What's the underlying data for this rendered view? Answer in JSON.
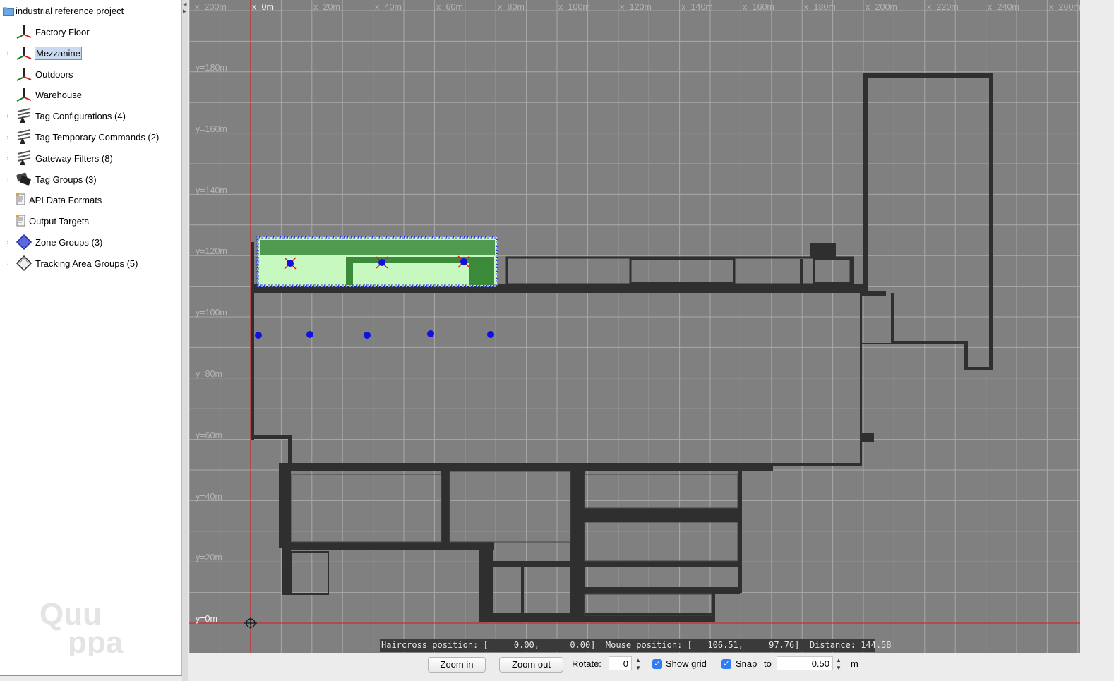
{
  "tree": {
    "root": {
      "label": "industrial reference project",
      "icon": "folder-icon"
    },
    "items": [
      {
        "label": "Factory Floor",
        "icon": "coordinate-axes-icon",
        "expandable": false,
        "selected": false
      },
      {
        "label": "Mezzanine",
        "icon": "coordinate-axes-icon",
        "expandable": true,
        "selected": true
      },
      {
        "label": "Outdoors",
        "icon": "coordinate-axes-icon",
        "expandable": false,
        "selected": false
      },
      {
        "label": "Warehouse",
        "icon": "coordinate-axes-icon",
        "expandable": false,
        "selected": false
      },
      {
        "label": "Tag Configurations (4)",
        "icon": "tag-config-icon",
        "expandable": true,
        "selected": false
      },
      {
        "label": "Tag Temporary Commands (2)",
        "icon": "tag-config-icon",
        "expandable": true,
        "selected": false
      },
      {
        "label": "Gateway Filters (8)",
        "icon": "tag-config-icon",
        "expandable": true,
        "selected": false
      },
      {
        "label": "Tag Groups (3)",
        "icon": "tag-group-icon",
        "expandable": true,
        "selected": false
      },
      {
        "label": "API Data Formats",
        "icon": "document-icon",
        "expandable": false,
        "selected": false
      },
      {
        "label": "Output Targets",
        "icon": "document-icon",
        "expandable": false,
        "selected": false
      },
      {
        "label": "Zone Groups (3)",
        "icon": "zone-diamond-icon",
        "expandable": true,
        "selected": false
      },
      {
        "label": "Tracking Area Groups (5)",
        "icon": "tracking-area-icon",
        "expandable": true,
        "selected": false
      }
    ]
  },
  "watermark": {
    "line1": "Quu",
    "line2": "ppa"
  },
  "canvas": {
    "x_labels": [
      "x=200m",
      "x=0m",
      "x=20m",
      "x=40m",
      "x=60m",
      "x=80m",
      "x=100m",
      "x=120m",
      "x=140m",
      "x=160m",
      "x=180m",
      "x=200m",
      "x=220m",
      "x=240m",
      "x=260m"
    ],
    "y_labels": [
      "y=180m",
      "y=160m",
      "y=140m",
      "y=120m",
      "y=100m",
      "y=80m",
      "y=60m",
      "y=40m",
      "y=20m",
      "y=0m"
    ]
  },
  "status": {
    "haircross_label": "Haircross position:",
    "haircross_value": "[     0.00,      0.00]",
    "mouse_label": "Mouse position:",
    "mouse_value": "[   106.51,     97.76]",
    "distance_label": "Distance:",
    "distance_value": "144.58"
  },
  "toolbar": {
    "zoom_in": "Zoom in",
    "zoom_out": "Zoom out",
    "rotate_label": "Rotate:",
    "rotate_value": "0",
    "show_grid_label": "Show grid",
    "show_grid_checked": true,
    "snap_label": "Snap",
    "snap_checked": true,
    "to_label": "to",
    "snap_value": "0.50",
    "unit": "m"
  },
  "colors": {
    "canvas_bg": "#808080",
    "grid": "#a9a9a9",
    "axis": "#e8101a",
    "walls": "#2f2f2f",
    "zone_fill": "#c6f8c0",
    "zone_border": "#2a3bd8",
    "locator": "#1010e0",
    "selection": "#c8d9f0"
  }
}
